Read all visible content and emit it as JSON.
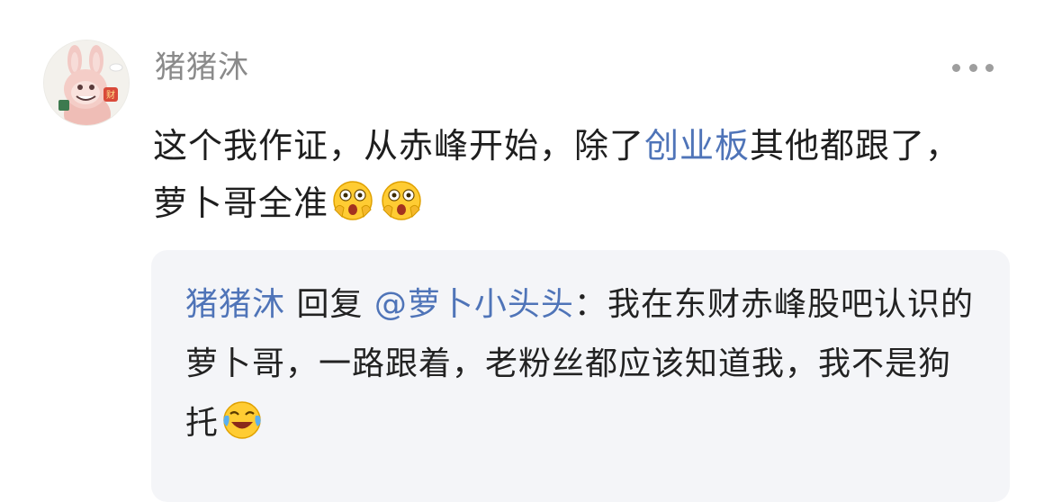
{
  "comment": {
    "username": "猪猪沐",
    "text_before_link": "这个我作证，从赤峰开始，除了",
    "link_text": "创业板",
    "text_after_link": "其他都跟了，萝卜哥全准",
    "trailing_emojis": [
      "shocked-face-icon",
      "shocked-face-icon"
    ],
    "more_icon": "more-dots-icon"
  },
  "reply": {
    "username": "猪猪沐",
    "reply_word": " 回复 ",
    "mention": "@萝卜小头头",
    "colon": "：",
    "text": "我在东财赤峰股吧认识的萝卜哥，一路跟着，老粉丝都应该知道我，我不是狗托",
    "trailing_emoji": "laughing-crying-face-icon"
  },
  "colors": {
    "link": "#4f74b8",
    "username": "#8a8a8a",
    "text": "#1e1e1e",
    "quote_bg": "#f4f5f8"
  }
}
